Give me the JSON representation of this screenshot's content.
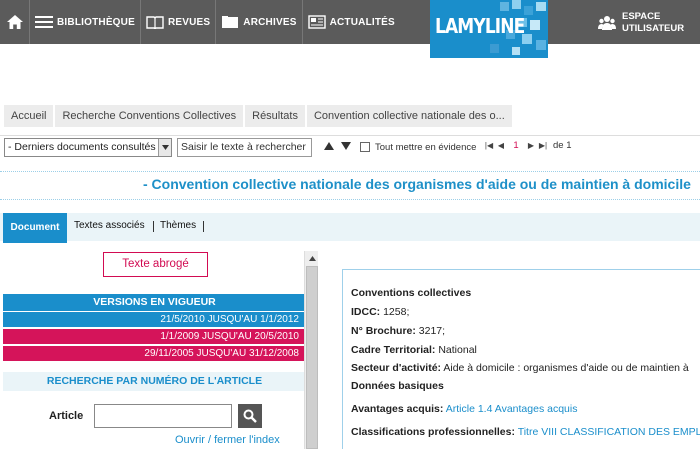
{
  "topnav": {
    "items": [
      {
        "label": "BIBLIOTHÈQUE",
        "icon": "menu-icon"
      },
      {
        "label": "REVUES",
        "icon": "book-icon"
      },
      {
        "label": "ARCHIVES",
        "icon": "folder-icon"
      },
      {
        "label": "ACTUALITÉS",
        "icon": "newspaper-icon"
      }
    ],
    "logo": "LAMYLINE",
    "espace_line1": "ESPACE",
    "espace_line2": "UTILISATEUR"
  },
  "colors": {
    "accent": "#1a8ecb",
    "danger": "#d5145a",
    "topbar": "#5b5b5b"
  },
  "breadcrumb": [
    "Accueil",
    "Recherche Conventions Collectives",
    "Résultats",
    "Convention collective nationale des o..."
  ],
  "toolbar": {
    "recent_select": "- Derniers documents consultés -",
    "search_value": "Saisir le texte à rechercher",
    "highlight_all": "Tout mettre en évidence",
    "page_current": "1",
    "page_total": "de 1"
  },
  "page_title": "- Convention collective nationale des organismes d'aide ou de maintien à domicile",
  "tabs": {
    "document": "Document",
    "textes": "Textes associés",
    "themes": "Thèmes"
  },
  "left": {
    "abroge": "Texte abrogé",
    "versions_head": "VERSIONS EN VIGUEUR",
    "versions": [
      "21/5/2010 JUSQU'AU 1/1/2012",
      "1/1/2009 JUSQU'AU 20/5/2010",
      "29/11/2005 JUSQU'AU 31/12/2008"
    ],
    "article_head": "RECHERCHE PAR NUMÉRO DE L'ARTICLE",
    "article_label": "Article",
    "article_value": "",
    "index_link": "Ouvrir / fermer l'index"
  },
  "doc": {
    "heading": "Conventions collectives",
    "idcc_label": "IDCC:",
    "idcc_value": " 1258;",
    "brochure_label": "N° Brochure:",
    "brochure_value": " 3217;",
    "cadre_label": "Cadre Territorial:",
    "cadre_value": " National",
    "secteur_label": "Secteur d'activité:",
    "secteur_value": " Aide à domicile : organismes d'aide ou de maintien à",
    "donnees": "Données basiques",
    "avantages_label": "Avantages acquis:",
    "avantages_link": "Article 1.4 Avantages acquis",
    "classif_label": "Classifications professionnelles:",
    "classif_link": "Titre VIII CLASSIFICATION DES EMPLOIS"
  }
}
